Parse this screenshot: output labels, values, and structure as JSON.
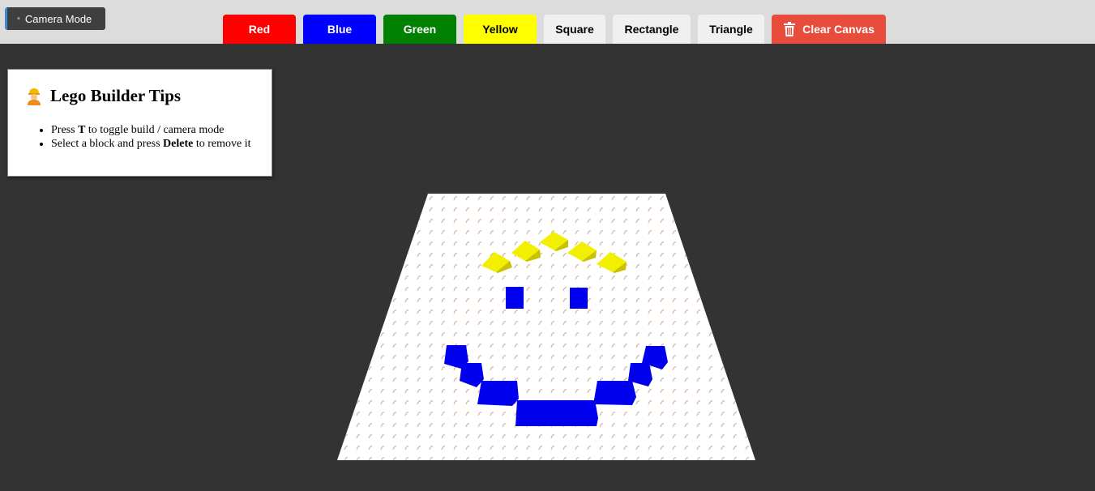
{
  "mode_button": {
    "label": "Camera Mode",
    "icon": "camera-icon"
  },
  "toolbar": {
    "colors": [
      {
        "label": "Red",
        "color": "#ff0000"
      },
      {
        "label": "Blue",
        "color": "#0000ff"
      },
      {
        "label": "Green",
        "color": "#008000"
      },
      {
        "label": "Yellow",
        "color": "#ffff00"
      }
    ],
    "shapes": [
      "Square",
      "Rectangle",
      "Triangle"
    ],
    "clear": {
      "label": "Clear Canvas",
      "icon": "trash-icon",
      "color": "#e74c3c"
    }
  },
  "tips": {
    "title": "Lego Builder Tips",
    "icon": "construction-worker-icon",
    "items": [
      {
        "before": "Press ",
        "key": "T",
        "after": " to toggle build / camera mode"
      },
      {
        "before": "Select a block and press ",
        "key": "Delete",
        "after": " to remove it"
      }
    ]
  },
  "colors": {
    "toolbar_bg": "#dcdcdc",
    "canvas_bg": "#333333",
    "baseplate": "#ffffff",
    "stud": "#d9b9a6"
  }
}
